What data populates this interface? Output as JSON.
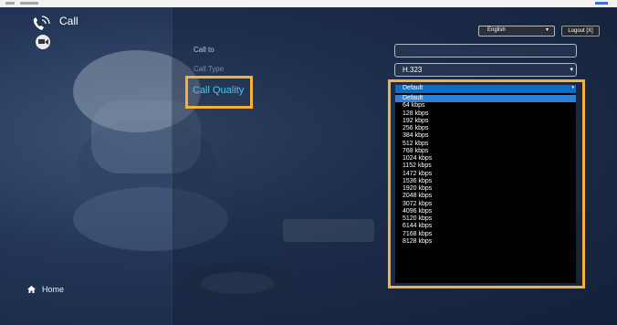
{
  "header": {
    "title": "Call",
    "language": {
      "selected": "English"
    },
    "logout_label": "Logout [X]"
  },
  "sidebar": {
    "home_label": "Home"
  },
  "form": {
    "call_to": {
      "label": "Call to",
      "value": ""
    },
    "call_type": {
      "label": "Call Type",
      "value": "H.323"
    },
    "call_quality": {
      "label": "Call Quality",
      "value": "Default",
      "options": [
        "Default",
        "64 kbps",
        "128 kbps",
        "192 kbps",
        "256 kbps",
        "384 kbps",
        "512 kbps",
        "768 kbps",
        "1024 kbps",
        "1152 kbps",
        "1472 kbps",
        "1536 kbps",
        "1920 kbps",
        "2048 kbps",
        "3072 kbps",
        "4096 kbps",
        "5120 kbps",
        "6144 kbps",
        "7168 kbps",
        "8128 kbps"
      ],
      "selected_index": 0
    }
  },
  "colors": {
    "highlight": "#f7b137",
    "accent": "#4fc2f2",
    "select_blue": "#0b6cc6"
  },
  "icons": {
    "call": "phone-wifi-icon",
    "camera": "video-camera-icon",
    "home": "home-icon",
    "dropdown": "chevron-down-icon"
  }
}
